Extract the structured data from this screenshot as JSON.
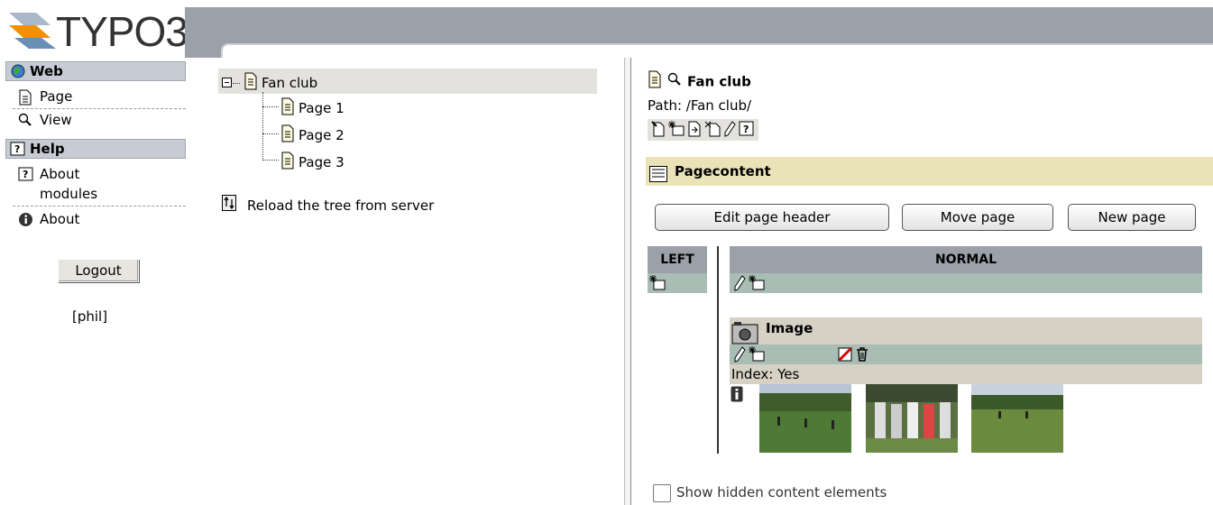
{
  "app": {
    "logo_text": "TYPO3"
  },
  "menu": {
    "sections": [
      {
        "label": "Web",
        "icon": "globe-icon"
      },
      {
        "label": "Help",
        "icon": "help-icon"
      }
    ],
    "items": {
      "page": "Page",
      "view": "View",
      "about_modules_1": "About",
      "about_modules_2": "modules",
      "about": "About"
    },
    "logout_label": "Logout",
    "username": "[phil]"
  },
  "tree": {
    "root": "Fan club",
    "children": [
      "Page 1",
      "Page 2",
      "Page 3"
    ],
    "reload_label": "Reload the tree from server"
  },
  "content": {
    "page_title": "Fan club",
    "path": "Path: /Fan club/",
    "section_title": "Pagecontent",
    "buttons": {
      "edit_header": "Edit page header",
      "move_page": "Move page",
      "new_page": "New page"
    },
    "columns": {
      "left": "LEFT",
      "normal": "NORMAL"
    },
    "element": {
      "type": "Image",
      "index_text": "Index: Yes"
    },
    "show_hidden_label": "Show hidden content elements"
  },
  "colors": {
    "header_grey": "#9ba0a9",
    "row_green": "#a9bdb5",
    "pagecontent_yellow": "#ebe3b8",
    "element_beige": "#d6d1c5"
  }
}
